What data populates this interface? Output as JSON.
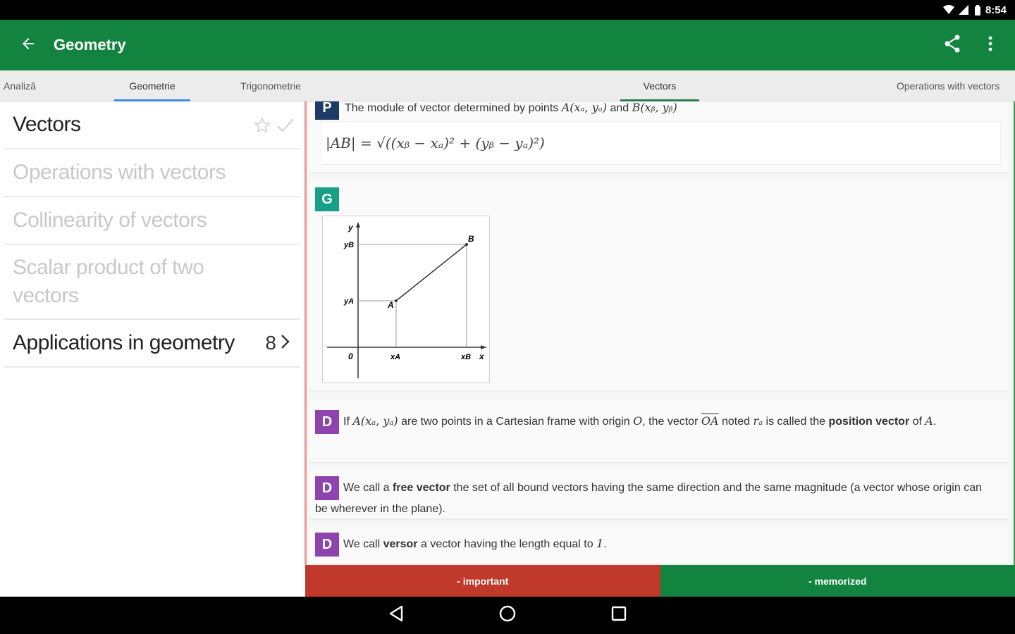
{
  "status_bar": {
    "time": "8:54",
    "icons": [
      "wifi-icon",
      "signal-icon",
      "battery-icon"
    ]
  },
  "app_bar": {
    "title": "Geometry",
    "back_icon": "arrow-left-icon",
    "actions": [
      "share-icon",
      "more-vert-icon"
    ]
  },
  "tabs": [
    {
      "label": "Analiză",
      "active": false
    },
    {
      "label": "Geometrie",
      "active": true
    },
    {
      "label": "Trigonometrie",
      "active": false
    },
    {
      "label": "Vectors",
      "active": true
    },
    {
      "label": "Operations with vectors",
      "active": false
    }
  ],
  "topics": [
    {
      "label": "Vectors",
      "dim": false
    },
    {
      "label": "Operations with vectors",
      "dim": true
    },
    {
      "label": "Collinearity of vectors",
      "dim": true
    },
    {
      "label": "Scalar product of two vectors",
      "dim": true
    },
    {
      "label": "Applications in geometry",
      "dim": false,
      "count": "8"
    }
  ],
  "cards": {
    "p": {
      "badge": "P",
      "text_before": "The module of vector determined by points ",
      "math_a": "A(xₐ, yₐ)",
      "text_and": " and ",
      "math_b": "B(xᵦ, yᵦ)",
      "formula": "|AB| = √((xᵦ − xₐ)² + (yᵦ − yₐ)²)"
    },
    "g": {
      "badge": "G",
      "graph_labels": {
        "y": "y",
        "x": "x",
        "origin": "0",
        "yB": "yB",
        "yA": "yA",
        "xA": "xA",
        "xB": "xB",
        "A": "A",
        "B": "B"
      }
    },
    "d1": {
      "badge": "D",
      "t1": "If ",
      "m1": "A(xₐ, yₐ)",
      "t2": " are two points in a Cartesian frame with origin ",
      "m2": "O",
      "t3": ", the vector ",
      "m3": "OA",
      "t4": " noted ",
      "m4": "rₐ",
      "t5": " is called the ",
      "b1": "position vector",
      "t6": " of ",
      "m5": "A",
      "t7": "."
    },
    "d2": {
      "badge": "D",
      "t1": "We call a ",
      "b1": "free vector",
      "t2": " the set of all bound vectors having the same direction and the same magnitude (a vector whose origin can be wherever in the plane)."
    },
    "d3": {
      "badge": "D",
      "t1": "We call ",
      "b1": "versor",
      "t2": " a vector having the length equal to ",
      "m1": "1",
      "t3": "."
    }
  },
  "bottom_buttons": {
    "important": "- important",
    "memorized": "- memorized",
    "important_color": "#c0392b",
    "memorized_color": "#13843f"
  },
  "nav": [
    "back-triangle-icon",
    "home-circle-icon",
    "recents-square-icon"
  ]
}
